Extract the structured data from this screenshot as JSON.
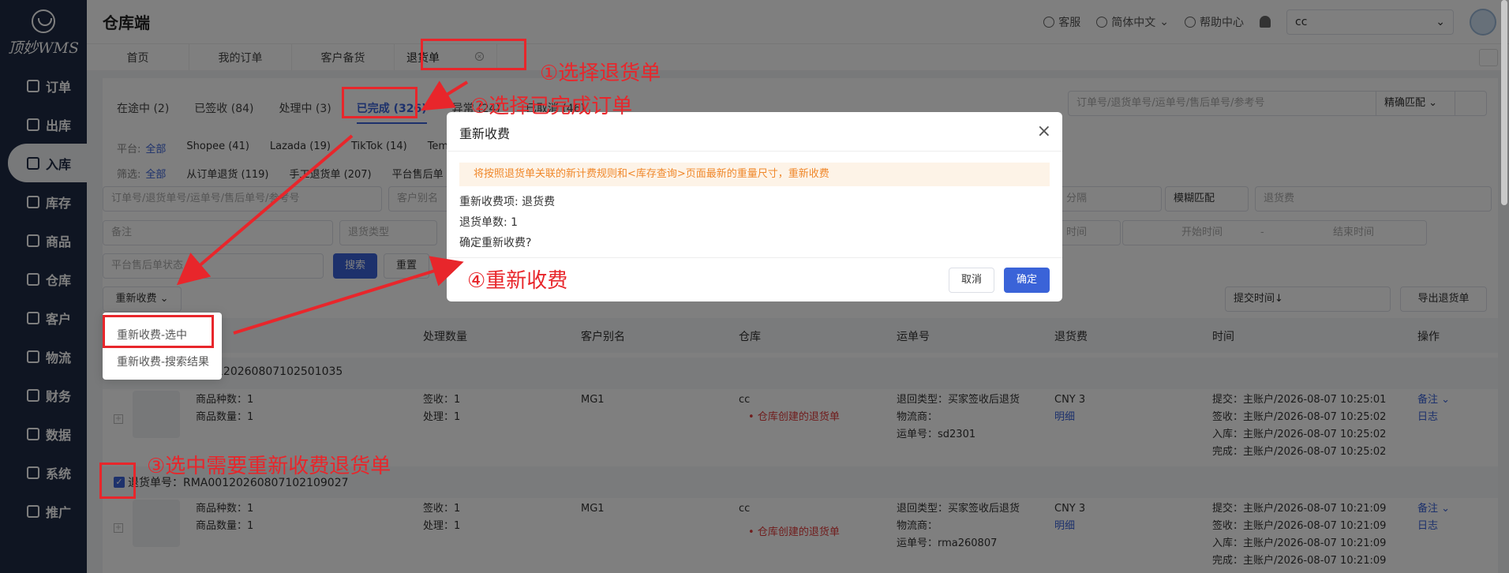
{
  "sidebar": {
    "logo": "顶妙WMS",
    "items": [
      {
        "label": "订单",
        "icon": "list-icon"
      },
      {
        "label": "出库",
        "icon": "outbound-icon"
      },
      {
        "label": "入库",
        "icon": "inbound-icon",
        "active": true
      },
      {
        "label": "库存",
        "icon": "inventory-icon"
      },
      {
        "label": "商品",
        "icon": "goods-icon"
      },
      {
        "label": "仓库",
        "icon": "warehouse-icon"
      },
      {
        "label": "客户",
        "icon": "customer-icon"
      },
      {
        "label": "物流",
        "icon": "logistics-icon"
      },
      {
        "label": "财务",
        "icon": "finance-icon"
      },
      {
        "label": "数据",
        "icon": "chart-icon"
      },
      {
        "label": "系统",
        "icon": "settings-icon"
      },
      {
        "label": "推广",
        "icon": "promo-icon"
      }
    ]
  },
  "header": {
    "title": "仓库端",
    "service": "客服",
    "language": "简体中文",
    "help": "帮助中心",
    "user_select": "cc"
  },
  "page_tabs": [
    "首页",
    "我的订单",
    "客户备货",
    "退货单"
  ],
  "status_tabs": [
    "在途中 (2)",
    "已签收 (84)",
    "处理中 (3)",
    "已完成 (326)",
    "异常 (24)",
    "已取消 (46)"
  ],
  "search": {
    "placeholder": "订单号/退货单号/运单号/售后单号/参考号",
    "mode": "精确匹配"
  },
  "platform_filter": {
    "label": "平台:",
    "options": [
      "全部",
      "Shopee (41)",
      "Lazada (19)",
      "TikTok (14)",
      "Tem"
    ]
  },
  "screen_filter": {
    "label": "筛选:",
    "options": [
      "全部",
      "从订单退货 (119)",
      "手工退货单 (207)",
      "平台售后单"
    ]
  },
  "filters": {
    "order_no_placeholder": "订单号/退货单号/运单号/售后单号/参考号",
    "customer_placeholder": "客户别名",
    "remark_placeholder": "备注",
    "return_type_placeholder": "退货类型",
    "after_sale_placeholder": "平台售后单状态",
    "separator_placeholder": "分隔",
    "fuzzy": "模糊匹配",
    "return_fee_placeholder": "退货费",
    "time_label": "时间",
    "start_placeholder": "开始时间",
    "range_dash": "-",
    "end_placeholder": "结束时间",
    "search_btn": "搜索",
    "reset_btn": "重置",
    "recharge_btn": "重新收费",
    "submit_time_sort": "提交时间↓",
    "export_btn": "导出退货单"
  },
  "dropdown": [
    "重新收费-选中",
    "重新收费-搜索结果"
  ],
  "table": {
    "headers": [
      "处理数量",
      "客户别名",
      "仓库",
      "运单号",
      "退货费",
      "时间",
      "操作"
    ],
    "rows": [
      {
        "return_no": "120260807102501035",
        "kinds": "商品种数：1",
        "count": "商品数量：1",
        "signed": "签收：1",
        "processed": "处理：1",
        "customer": "MG1",
        "warehouse": "cc",
        "warehouse_note": "仓库创建的退货单",
        "return_type": "退回类型：买家签收后退货",
        "carrier": "物流商：",
        "tracking": "运单号：sd2301",
        "fee": "CNY 3",
        "fee_detail": "明细",
        "times": [
          "提交：主账户/2026-08-07 10:25:01",
          "签收：主账户/2026-08-07 10:25:02",
          "入库：主账户/2026-08-07 10:25:02",
          "完成：主账户/2026-08-07 10:25:02"
        ],
        "actions": [
          "备注",
          "日志"
        ]
      },
      {
        "return_no_label": "退货单号：RMA00120260807102109027",
        "kinds": "商品种数：1",
        "count": "商品数量：1",
        "signed": "签收：1",
        "processed": "处理：1",
        "customer": "MG1",
        "warehouse": "cc",
        "warehouse_note": "仓库创建的退货单",
        "return_type": "退回类型：买家签收后退货",
        "carrier": "物流商：",
        "tracking": "运单号：rma260807",
        "fee": "CNY 3",
        "fee_detail": "明细",
        "times": [
          "提交：主账户/2026-08-07 10:21:09",
          "签收：主账户/2026-08-07 10:21:09",
          "入库：主账户/2026-08-07 10:21:09",
          "完成：主账户/2026-08-07 10:21:09"
        ],
        "actions": [
          "备注",
          "日志"
        ]
      }
    ]
  },
  "modal": {
    "title": "重新收费",
    "notice": "将按照退货单关联的新计费规则和<库存查询>页面最新的重量尺寸，重新收费",
    "item": "重新收费项:   退货费",
    "count": "退货单数:   1",
    "confirm": "确定重新收费?",
    "cancel": "取消",
    "ok": "确定"
  },
  "annotations": [
    "①选择退货单",
    "②选择已完成订单",
    "③选中需要重新收费退货单",
    "④重新收费"
  ],
  "colors": {
    "primary": "#3a63d8",
    "annotation": "#e8262b",
    "sidebar": "#1f2a44",
    "notice": "#f0882b"
  }
}
